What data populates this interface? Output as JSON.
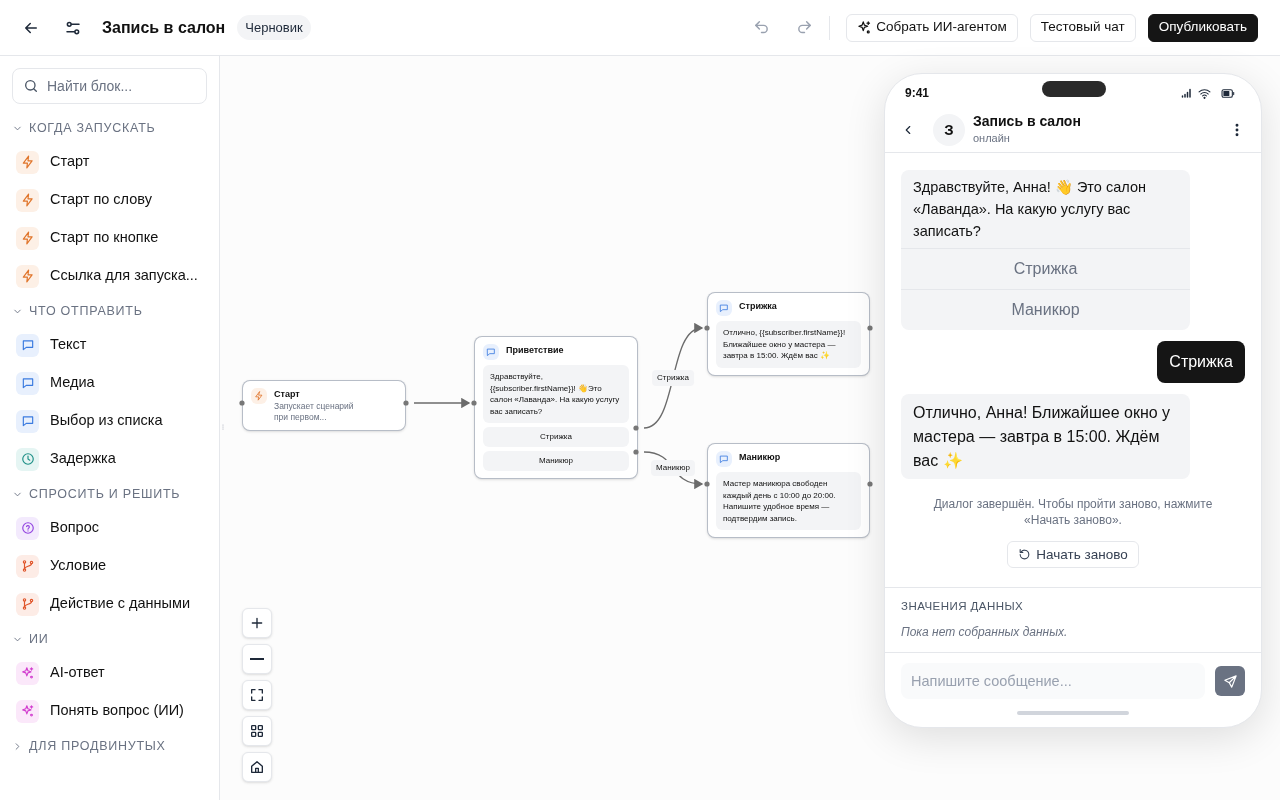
{
  "header": {
    "title": "Запись в салон",
    "status": "Черновик",
    "buttons": [
      {
        "label": "Собрать ИИ-агентом",
        "kind": "ai"
      },
      {
        "label": "Тестовый чат",
        "kind": "outline"
      },
      {
        "label": "Опубликовать",
        "kind": "primary"
      }
    ]
  },
  "sidebar": {
    "search": {
      "placeholder": "Найти блок..."
    },
    "sections": [
      {
        "title": "КОГДА ЗАПУСКАТЬ",
        "expanded": true,
        "items": [
          {
            "label": "Старт",
            "kind": "trigger"
          },
          {
            "label": "Старт по слову",
            "kind": "trigger"
          },
          {
            "label": "Старт по кнопке",
            "kind": "trigger"
          },
          {
            "label": "Ссылка для запуска...",
            "kind": "trigger"
          }
        ]
      },
      {
        "title": "ЧТО ОТПРАВИТЬ",
        "expanded": true,
        "items": [
          {
            "label": "Текст",
            "kind": "message"
          },
          {
            "label": "Медиа",
            "kind": "message"
          },
          {
            "label": "Выбор из списка",
            "kind": "message"
          },
          {
            "label": "Задержка",
            "kind": "delay"
          }
        ]
      },
      {
        "title": "СПРОСИТЬ И РЕШИТЬ",
        "expanded": true,
        "items": [
          {
            "label": "Вопрос",
            "kind": "question"
          },
          {
            "label": "Условие",
            "kind": "condition"
          },
          {
            "label": "Действие с данными",
            "kind": "condition"
          }
        ]
      },
      {
        "title": "ИИ",
        "expanded": true,
        "items": [
          {
            "label": "AI-ответ",
            "kind": "ai"
          },
          {
            "label": "Понять вопрос (ИИ)",
            "kind": "ai"
          }
        ]
      },
      {
        "title": "ДЛЯ ПРОДВИНУТЫХ",
        "expanded": false
      }
    ]
  },
  "canvas": {
    "nodes": [
      {
        "kind": "trigger",
        "title": "Старт",
        "subtitle": "Запускает сценарий при первом..."
      },
      {
        "kind": "message",
        "title": "Приветствие",
        "text": "Здравствуйте, {{subscriber.firstName}}! 👋Это салон «Лаванда». На какую услугу вас записать?",
        "buttons": [
          "Стрижка",
          "Маникюр"
        ]
      },
      {
        "kind": "message",
        "title": "Стрижка",
        "text": "Отлично, {{subscriber.firstName}}! Ближайшее окно у мастера — завтра в 15:00. Ждём вас ✨"
      },
      {
        "kind": "message",
        "title": "Маникюр",
        "text": "Мастер маникюра свободен каждый день с 10:00 до 20:00. Напишите удобное время — подтвердим запись."
      }
    ],
    "edge_labels": [
      "Стрижка",
      "Маникюр"
    ]
  },
  "preview": {
    "time": "9:41",
    "avatar": "З",
    "name": "Запись в салон",
    "status": "онлайн",
    "messages": [
      {
        "kind": "bot",
        "text": "Здравствуйте, Анна! 👋 Это салон «Лаванда». На какую услугу вас записать?",
        "buttons": [
          "Стрижка",
          "Маникюр"
        ]
      },
      {
        "kind": "user",
        "text": "Стрижка"
      },
      {
        "kind": "bot",
        "text": "Отлично, Анна! Ближайшее окно у мастера — завтра в 15:00. Ждём вас ✨"
      }
    ],
    "note": "Диалог завершён. Чтобы пройти заново, нажмите «Начать заново».",
    "restart": "Начать заново",
    "data_title": "ЗНАЧЕНИЯ ДАННЫХ",
    "data_empty": "Пока нет собранных данных.",
    "input": {
      "placeholder": "Напишите сообщение..."
    }
  }
}
